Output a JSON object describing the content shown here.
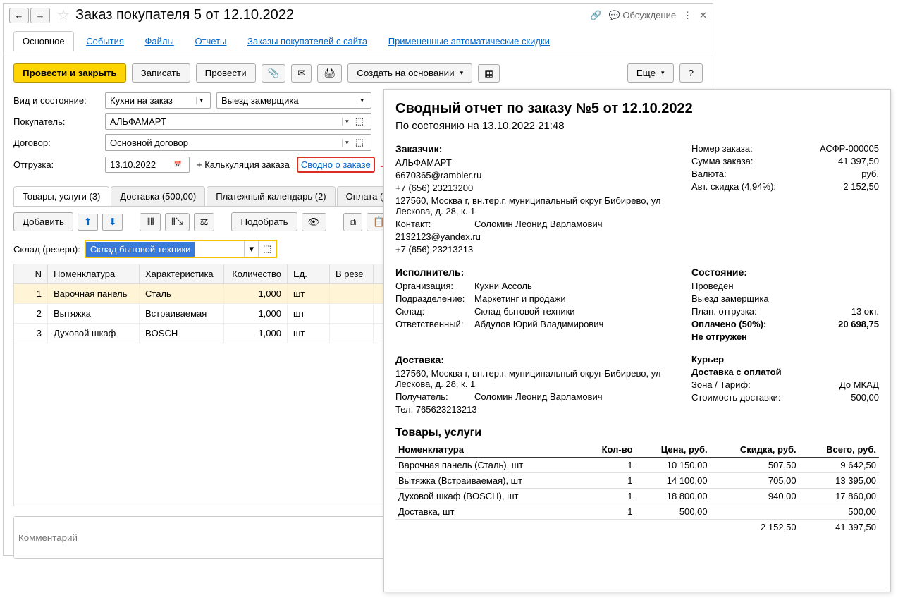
{
  "title": "Заказ покупателя 5 от 12.10.2022",
  "tabs": {
    "main": "Основное",
    "events": "События",
    "files": "Файлы",
    "reports": "Отчеты",
    "site_orders": "Заказы покупателей с сайта",
    "auto_discounts": "Примененные автоматические скидки"
  },
  "titlebar": {
    "discuss": "Обсуждение"
  },
  "toolbar": {
    "post_close": "Провести и закрыть",
    "save": "Записать",
    "post": "Провести",
    "create_based": "Создать на основании",
    "more": "Еще",
    "help": "?"
  },
  "form": {
    "kind_label": "Вид и состояние:",
    "kind_value": "Кухни на заказ",
    "state_value": "Выезд замерщика",
    "buyer_label": "Покупатель:",
    "buyer_value": "АЛЬФАМАРТ",
    "contract_label": "Договор:",
    "contract_value": "Основной договор",
    "shipment_label": "Отгрузка:",
    "shipment_date": "13.10.2022",
    "calc_link": "+ Калькуляция заказа",
    "summary_link": "Сводно о заказе"
  },
  "subtabs": {
    "goods": "Товары, услуги (3)",
    "delivery": "Доставка (500,00)",
    "payment_cal": "Платежный календарь (2)",
    "payment": "Оплата (Вручн"
  },
  "subtoolbar": {
    "add": "Добавить",
    "pick": "Подобрать"
  },
  "warehouse": {
    "label": "Склад (резерв):",
    "value": "Склад бытовой техники"
  },
  "table": {
    "headers": {
      "n": "N",
      "nom": "Номенклатура",
      "char": "Характеристика",
      "qty": "Количество",
      "unit": "Ед.",
      "res": "В резе"
    },
    "rows": [
      {
        "n": "1",
        "nom": "Варочная панель",
        "char": "Сталь",
        "qty": "1,000",
        "unit": "шт"
      },
      {
        "n": "2",
        "nom": "Вытяжка",
        "char": "Встраиваемая",
        "qty": "1,000",
        "unit": "шт"
      },
      {
        "n": "3",
        "nom": "Духовой шкаф",
        "char": "BOSCH",
        "qty": "1,000",
        "unit": "шт"
      }
    ]
  },
  "comment_placeholder": "Комментарий",
  "report": {
    "title": "Сводный отчет по заказу №5 от 12.10.2022",
    "asof": "По состоянию на 13.10.2022 21:48",
    "customer": {
      "heading": "Заказчик:",
      "name": "АЛЬФАМАРТ",
      "email": "6670365@rambler.ru",
      "phone": "+7 (656) 23213200",
      "address": "127560, Москва г, вн.тер.г. муниципальный округ Бибирево, ул Лескова, д. 28, к. 1",
      "contact_label": "Контакт:",
      "contact": "Соломин Леонид Варламович",
      "contact_email": "2132123@yandex.ru",
      "contact_phone": "+7 (656) 23213213"
    },
    "order_summary": {
      "num_label": "Номер заказа:",
      "num": "АСФР-000005",
      "sum_label": "Сумма заказа:",
      "sum": "41 397,50",
      "cur_label": "Валюта:",
      "cur": "руб.",
      "disc_label": "Авт. скидка (4,94%):",
      "disc": "2 152,50"
    },
    "executor": {
      "heading": "Исполнитель:",
      "org_label": "Организация:",
      "org": "Кухни Ассоль",
      "dept_label": "Подразделение:",
      "dept": "Маркетинг и продажи",
      "wh_label": "Склад:",
      "wh": "Склад бытовой техники",
      "resp_label": "Ответственный:",
      "resp": "Абдулов Юрий Владимирович"
    },
    "status": {
      "heading": "Состояние:",
      "posted": "Проведен",
      "state": "Выезд замерщика",
      "plan_label": "План. отгрузка:",
      "plan": "13 окт.",
      "paid_label": "Оплачено (50%):",
      "paid": "20 698,75",
      "not_shipped": "Не отгружен"
    },
    "delivery": {
      "heading": "Доставка:",
      "address": "127560, Москва г, вн.тер.г. муниципальный округ Бибирево, ул Лескова, д. 28, к. 1",
      "recv_label": "Получатель:",
      "recv": "Соломин Леонид Варламович",
      "tel": "Тел. 765623213213",
      "courier": "Курьер",
      "with_pay": "Доставка с оплатой",
      "zone_label": "Зона / Тариф:",
      "zone": "До МКАД",
      "cost_label": "Стоимость доставки:",
      "cost": "500,00"
    },
    "goods_heading": "Товары, услуги",
    "goods_headers": {
      "nom": "Номенклатура",
      "qty": "Кол-во",
      "price": "Цена, руб.",
      "disc": "Скидка, руб.",
      "total": "Всего, руб."
    },
    "goods": [
      {
        "nom": "Варочная панель (Сталь), шт",
        "qty": "1",
        "price": "10 150,00",
        "disc": "507,50",
        "total": "9 642,50"
      },
      {
        "nom": "Вытяжка (Встраиваемая), шт",
        "qty": "1",
        "price": "14 100,00",
        "disc": "705,00",
        "total": "13 395,00"
      },
      {
        "nom": "Духовой шкаф (BOSCH), шт",
        "qty": "1",
        "price": "18 800,00",
        "disc": "940,00",
        "total": "17 860,00"
      },
      {
        "nom": "Доставка, шт",
        "qty": "1",
        "price": "500,00",
        "disc": "",
        "total": "500,00"
      }
    ],
    "totals": {
      "disc": "2 152,50",
      "sum": "41 397,50"
    }
  }
}
